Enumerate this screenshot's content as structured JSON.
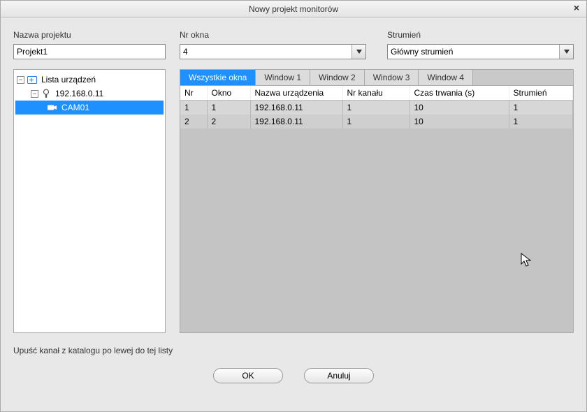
{
  "window": {
    "title": "Nowy projekt monitorów"
  },
  "labels": {
    "project_name": "Nazwa projektu",
    "window_no": "Nr okna",
    "stream": "Strumień",
    "hint": "Upuść kanał z katalogu po lewej do tej listy"
  },
  "project_name_value": "Projekt1",
  "window_no_value": "4",
  "stream_value": "Główny strumień",
  "tree": {
    "root": "Lista urządzeń",
    "device": "192.168.0.11",
    "channel": "CAM01"
  },
  "tabs": [
    "Wszystkie okna",
    "Window 1",
    "Window 2",
    "Window 3",
    "Window 4"
  ],
  "active_tab": 0,
  "columns": [
    "Nr",
    "Okno",
    "Nazwa urządzenia",
    "Nr kanału",
    "Czas trwania (s)",
    "Strumień"
  ],
  "rows": [
    {
      "nr": "1",
      "okno": "1",
      "nazwa": "192.168.0.11",
      "kanal": "1",
      "czas": "10",
      "strum": "1"
    },
    {
      "nr": "2",
      "okno": "2",
      "nazwa": "192.168.0.11",
      "kanal": "1",
      "czas": "10",
      "strum": "1"
    }
  ],
  "buttons": {
    "ok": "OK",
    "cancel": "Anuluj"
  }
}
